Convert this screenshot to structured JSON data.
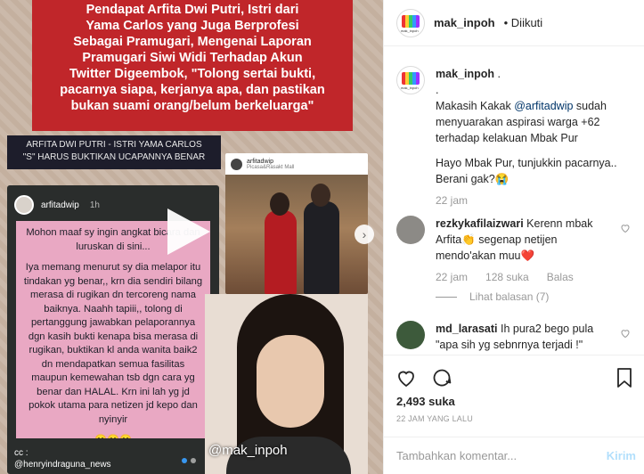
{
  "media": {
    "headline_lines": [
      "Pendapat Arfita Dwi Putri, Istri dari",
      "Yama Carlos yang Juga Berprofesi",
      "Sebagai Pramugari, Mengenai Laporan",
      "Pramugari Siwi Widi Terhadap Akun",
      "Twitter Digeembok, \"Tolong sertai bukti,",
      "pacarnya siapa, kerjanya apa, dan pastikan",
      "bukan suami orang/belum berkeluarga\""
    ],
    "caption_line1": "ARFITA DWI PUTRI - ISTRI YAMA CARLOS",
    "caption_line2": "\"S\" HARUS BUKTIKAN UCAPANNYA BENAR",
    "story_user": "arfitadwip",
    "story_time": "1h",
    "story_paragraphs": [
      "Mohon maaf sy ingin angkat bicara dan luruskan di sini...",
      "Iya memang menurut sy dia melapor itu tindakan yg benar,, krn dia sendiri bilang merasa di rugikan dn tercoreng nama baiknya. Naahh tapiii,, tolong di pertanggung jawabkan pelaporannya dgn kasih bukti kenapa bisa merasa di rugikan, buktikan kl anda wanita baik2 dn mendapatkan semua fasilitas maupun kemewahan tsb dgn cara yg benar dan HALAL. Krn ini lah yg jd pokok utama para netizen jd kepo dan nyinyir",
      "😄😄😄"
    ],
    "story_foot1": "cc :",
    "story_foot2": "@henryindraguna_news",
    "ig_card_user": "arfitadwip",
    "ig_card_sub": "Picasa&Rasakt Mall",
    "face_tag": "@mak_inpoh",
    "next_glyph": "›"
  },
  "header": {
    "username": "mak_inpoh",
    "follow_status": "• Diikuti",
    "avatar_label": "mak_inpoh"
  },
  "caption": {
    "username": "mak_inpoh",
    "line_dot1": ".",
    "line_dot2": ".",
    "text_before_mention": "Makasih Kakak ",
    "mention": "@arfitadwip",
    "text_after_mention": " sudah menyuarakan aspirasi warga +62 terhadap kelakuan Mbak Pur",
    "text2": "Hayo Mbak Pur, tunjukkin pacarnya.. Berani gak?😭",
    "time": "22 jam"
  },
  "comments": [
    {
      "username": "rezkykafilaizwari",
      "text": "Kerenn mbak Arfita👏 segenap netijen mendo'akan muu❤️",
      "time": "22 jam",
      "likes": "128 suka",
      "reply": "Balas",
      "view_replies": "Lihat balasan (7)"
    },
    {
      "username": "md_larasati",
      "text": "Ih pura2 bego pula \"apa sih yg sebnrnya terjadi !\""
    }
  ],
  "actions": {
    "likes": "2,493 suka",
    "time_ago": "22 JAM YANG LALU"
  },
  "add_comment": {
    "placeholder": "Tambahkan komentar...",
    "post": "Kirim"
  }
}
